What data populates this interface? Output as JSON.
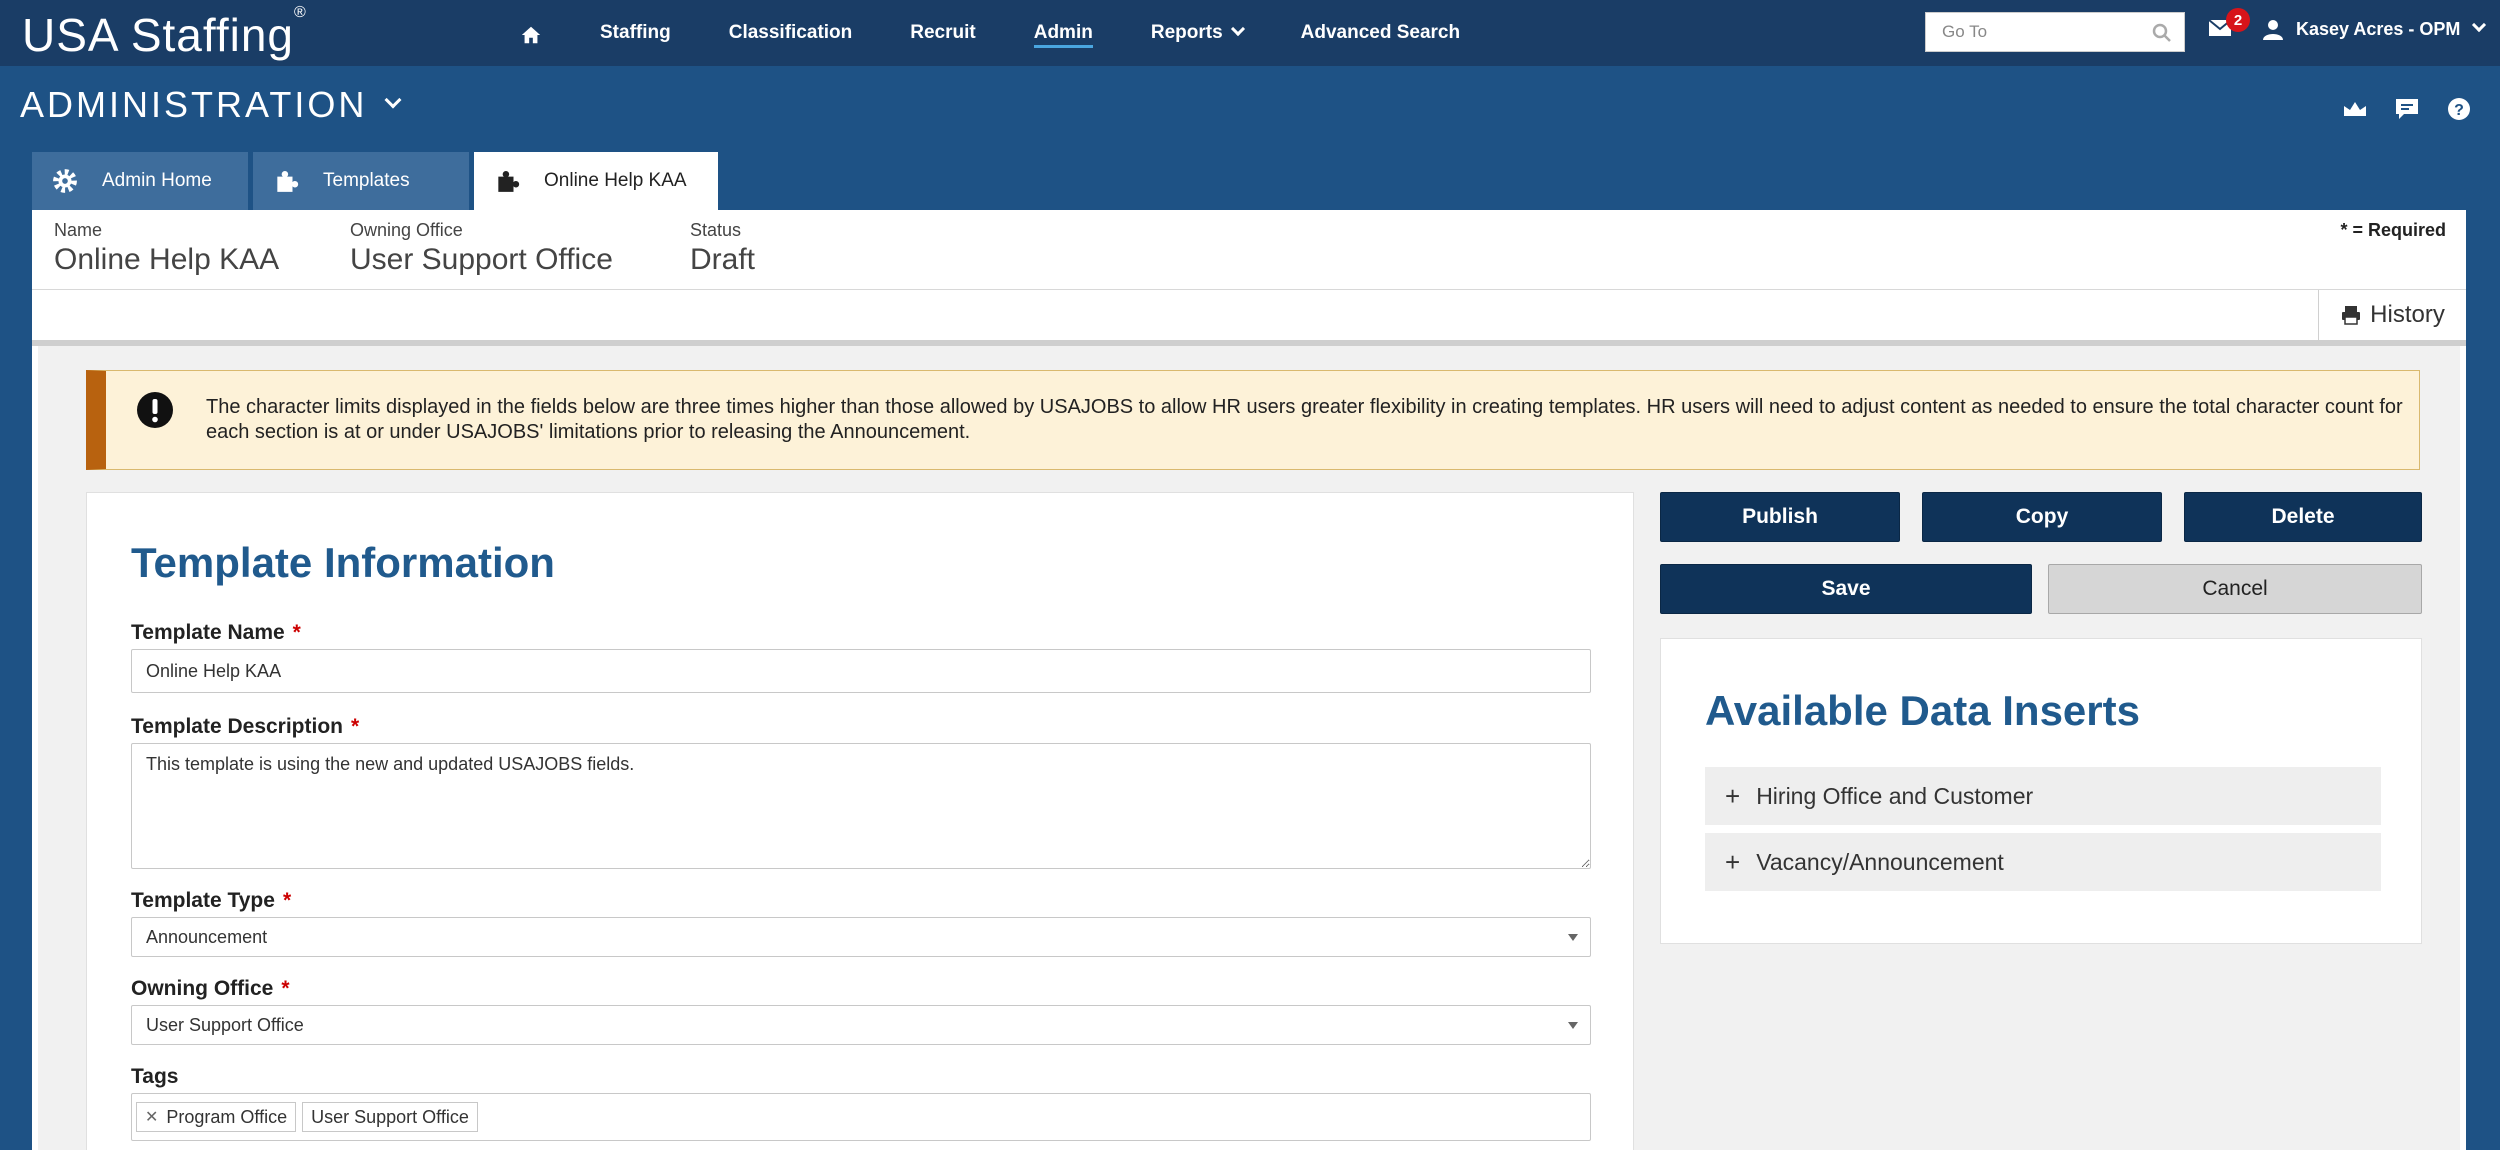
{
  "app": {
    "brand": "USA Staffing",
    "brand_mark": "®"
  },
  "nav": {
    "home_icon": "home-icon",
    "items": [
      {
        "label": "Staffing"
      },
      {
        "label": "Classification"
      },
      {
        "label": "Recruit"
      },
      {
        "label": "Admin",
        "active": true
      },
      {
        "label": "Reports",
        "dropdown": true
      },
      {
        "label": "Advanced Search"
      }
    ],
    "goto_placeholder": "Go To",
    "notification_count": "2",
    "user_name": "Kasey Acres - OPM"
  },
  "section": {
    "title": "ADMINISTRATION",
    "icons": [
      "dashboard-icon",
      "feedback-icon",
      "help-icon"
    ]
  },
  "tabs": [
    {
      "label": "Admin Home",
      "icon": "gear-icon"
    },
    {
      "label": "Templates",
      "icon": "puzzle-icon"
    },
    {
      "label": "Online Help KAA",
      "icon": "puzzle-icon",
      "active": true
    }
  ],
  "meta": {
    "name_label": "Name",
    "name_value": "Online Help KAA",
    "office_label": "Owning Office",
    "office_value": "User Support Office",
    "status_label": "Status",
    "status_value": "Draft",
    "required_note": "* = Required",
    "history_label": "History"
  },
  "alert": {
    "text": "The character limits displayed in the fields below are three times higher than those allowed by USAJOBS to allow HR users greater flexibility in creating templates. HR users will need to adjust content as needed to ensure the total character count for each section is at or under USAJOBS' limitations prior to releasing the Announcement."
  },
  "form": {
    "title": "Template Information",
    "template_name_label": "Template Name",
    "template_name_value": "Online Help KAA",
    "description_label": "Template Description",
    "description_value": "This template is using the new and updated USAJOBS fields.",
    "type_label": "Template Type",
    "type_value": "Announcement",
    "owning_office_label": "Owning Office",
    "owning_office_value": "User Support Office",
    "tags_label": "Tags",
    "tags": [
      "Program Office",
      "User Support Office"
    ],
    "required_mark": "*"
  },
  "actions": {
    "publish": "Publish",
    "copy": "Copy",
    "delete": "Delete",
    "save": "Save",
    "cancel": "Cancel"
  },
  "inserts": {
    "title": "Available Data Inserts",
    "items": [
      {
        "label": "Hiring Office and Customer"
      },
      {
        "label": "Vacancy/Announcement"
      }
    ]
  },
  "colors": {
    "topbar": "#1a3d66",
    "background": "#1e5285",
    "primary_button": "#0f3359",
    "heading": "#205a8d",
    "alert_bg": "#fdf2d8",
    "alert_accent": "#b8620f",
    "badge": "#d7141a"
  }
}
